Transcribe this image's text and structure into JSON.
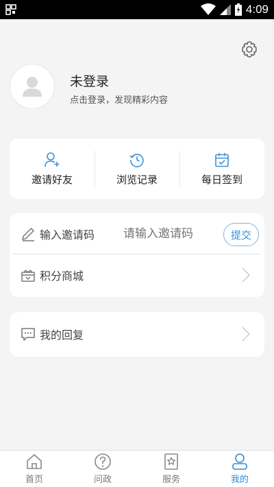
{
  "status_bar": {
    "time": "4:09"
  },
  "profile": {
    "title": "未登录",
    "subtitle": "点击登录，发现精彩内容"
  },
  "quick_actions": [
    {
      "label": "邀请好友",
      "icon": "add-user-icon"
    },
    {
      "label": "浏览记录",
      "icon": "history-icon"
    },
    {
      "label": "每日签到",
      "icon": "calendar-check-icon"
    }
  ],
  "invite": {
    "label": "输入邀请码",
    "placeholder": "请输入邀请码",
    "submit_label": "提交"
  },
  "mall": {
    "label": "积分商城"
  },
  "reply": {
    "label": "我的回复"
  },
  "tabs": [
    {
      "label": "首页",
      "icon": "home-icon",
      "active": false
    },
    {
      "label": "问政",
      "icon": "question-icon",
      "active": false
    },
    {
      "label": "服务",
      "icon": "star-bookmark-icon",
      "active": false
    },
    {
      "label": "我的",
      "icon": "user-icon",
      "active": true
    }
  ],
  "colors": {
    "accent": "#2e8bd8",
    "background": "#f4f4f4"
  }
}
